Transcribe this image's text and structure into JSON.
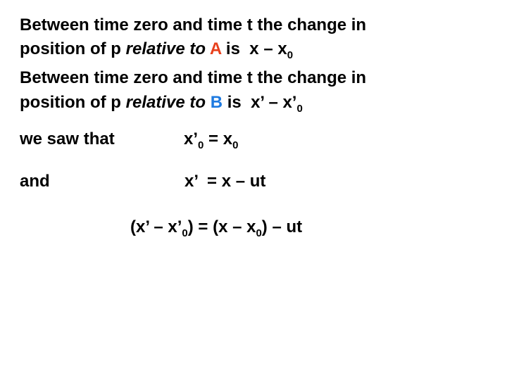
{
  "slide": {
    "paragraph_a": {
      "line1": "Between time zero and time t the change in",
      "line2_prefix": "position of p ",
      "line2_italic": "relative to",
      "line2_space": " ",
      "frame_label": "A",
      "line2_is": " is  ",
      "expr_main": "x – x",
      "expr_sub": "0",
      "frame_color": "#e8401c"
    },
    "paragraph_b": {
      "line1": "Between time zero and time t the change in",
      "line2_prefix": "position of p ",
      "line2_italic": "relative to",
      "line2_space": " ",
      "frame_label": "B",
      "line2_is": " is  ",
      "expr_main": "x’ – x’",
      "expr_sub": "0",
      "frame_color": "#1e7ae0"
    },
    "statement_1": {
      "label": "we saw that",
      "lhs": "x’",
      "lhs_sub": "0",
      "op": " = x",
      "rhs_sub": "0"
    },
    "statement_2": {
      "label": "and",
      "equation": "x’  = x – ut"
    },
    "result": {
      "part1": "(x’ – x’",
      "sub1": "0",
      "part2": ") = (x – x",
      "sub2": "0",
      "part3": ") – ut"
    }
  }
}
